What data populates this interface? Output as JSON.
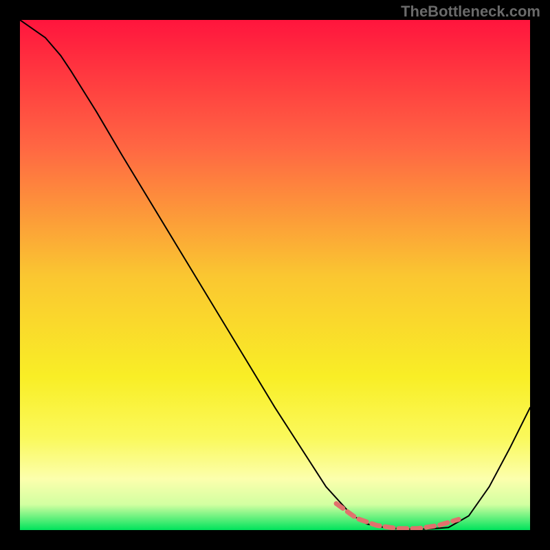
{
  "watermark": "TheBottleneck.com",
  "chart_data": {
    "type": "line",
    "title": "",
    "xlabel": "",
    "ylabel": "",
    "xlim": [
      0,
      100
    ],
    "ylim": [
      0,
      100
    ],
    "background": {
      "type": "vertical_gradient",
      "stops": [
        {
          "pos": 0.0,
          "color": "#ff153d"
        },
        {
          "pos": 0.25,
          "color": "#ff6743"
        },
        {
          "pos": 0.5,
          "color": "#fac631"
        },
        {
          "pos": 0.7,
          "color": "#f9ee26"
        },
        {
          "pos": 0.82,
          "color": "#faf95c"
        },
        {
          "pos": 0.9,
          "color": "#fcffad"
        },
        {
          "pos": 0.95,
          "color": "#d2ffa1"
        },
        {
          "pos": 1.0,
          "color": "#00e35c"
        }
      ]
    },
    "series": [
      {
        "name": "curve",
        "color": "#000000",
        "width": 2,
        "x": [
          0,
          5,
          8,
          10,
          15,
          20,
          30,
          40,
          50,
          60,
          65,
          68,
          72,
          76,
          80,
          84,
          88,
          92,
          96,
          100
        ],
        "y": [
          100,
          96.5,
          93,
          90,
          82,
          73.5,
          57,
          40.5,
          24,
          8.5,
          3,
          1.2,
          0.4,
          0.2,
          0.2,
          0.5,
          2.8,
          8.5,
          16,
          24
        ]
      },
      {
        "name": "bottom_highlight",
        "color": "#e0716d",
        "width": 7,
        "dasharray": "12 8",
        "x": [
          62,
          66,
          70,
          74,
          78,
          82,
          86
        ],
        "y": [
          5.2,
          2.3,
          0.9,
          0.3,
          0.3,
          0.9,
          2.1
        ]
      }
    ]
  }
}
